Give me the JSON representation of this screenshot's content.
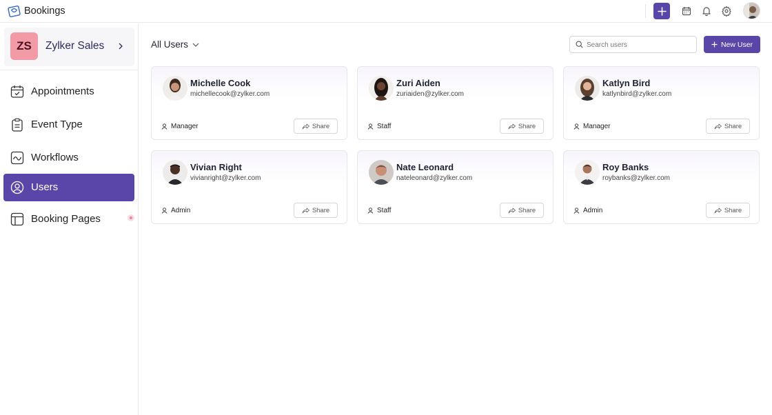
{
  "app": {
    "title": "Bookings"
  },
  "topbar": {
    "icons": [
      "plus-icon",
      "calendar-icon",
      "bell-icon",
      "gear-icon",
      "profile-avatar"
    ]
  },
  "org": {
    "initials": "ZS",
    "name": "Zylker Sales"
  },
  "sidebar": {
    "items": [
      {
        "label": "Appointments",
        "icon": "calendar-check-icon",
        "active": false
      },
      {
        "label": "Event Type",
        "icon": "clipboard-icon",
        "active": false
      },
      {
        "label": "Workflows",
        "icon": "workflow-icon",
        "active": false
      },
      {
        "label": "Users",
        "icon": "user-circle-icon",
        "active": true
      },
      {
        "label": "Booking Pages",
        "icon": "booking-page-icon",
        "active": false
      }
    ]
  },
  "main": {
    "filter_label": "All Users",
    "search_placeholder": "Search users",
    "new_user_label": "New User",
    "share_label": "Share",
    "users": [
      {
        "name": "Michelle Cook",
        "email": "michellecook@zylker.com",
        "role": "Manager"
      },
      {
        "name": "Zuri Aiden",
        "email": "zuriaiden@zylker.com",
        "role": "Staff"
      },
      {
        "name": "Katlyn Bird",
        "email": "katlynbird@zylker.com",
        "role": "Manager"
      },
      {
        "name": "Vivian Right",
        "email": "vivianright@zylker.com",
        "role": "Admin"
      },
      {
        "name": "Nate Leonard",
        "email": "nateleonard@zylker.com",
        "role": "Staff"
      },
      {
        "name": "Roy Banks",
        "email": "roybanks@zylker.com",
        "role": "Admin"
      }
    ]
  },
  "colors": {
    "accent": "#5a46a8",
    "org_badge": "#f29aa6",
    "border": "#e6e6ee"
  }
}
